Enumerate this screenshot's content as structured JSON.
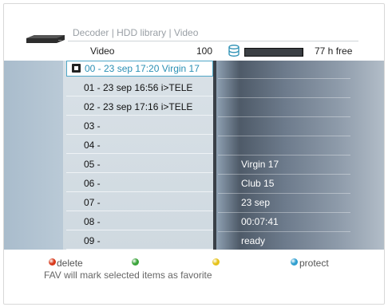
{
  "header": {
    "breadcrumb": "Decoder | HDD library | Video",
    "title": "Video",
    "count": "100",
    "disk_free": "77 h free",
    "disk_used_fraction": 0.98
  },
  "recordings": [
    {
      "label": "00 - 23 sep 17:20 Virgin 17",
      "selected": true,
      "locked": true
    },
    {
      "label": "01 - 23 sep 16:56 i>TELE"
    },
    {
      "label": "02 - 23 sep 17:16 i>TELE"
    },
    {
      "label": "03 -"
    },
    {
      "label": "04 -"
    },
    {
      "label": "05 -"
    },
    {
      "label": "06 -"
    },
    {
      "label": "07 -"
    },
    {
      "label": "08 -"
    },
    {
      "label": "09 -"
    }
  ],
  "details": {
    "channel": "Virgin 17",
    "programme": "Club 15",
    "date": "23 sep",
    "duration": "00:07:41",
    "status": "ready"
  },
  "footer": {
    "red_label": "delete",
    "green_label": "",
    "yellow_label": "",
    "blue_label": "protect",
    "note": "FAV will mark selected items as favorite"
  },
  "colors": {
    "selection_text": "#2a8fb4",
    "selection_border": "#4ea6c6",
    "red": "#d83a1c",
    "green": "#3aa43a",
    "yellow": "#e6c21a",
    "blue": "#2f9fd0"
  }
}
